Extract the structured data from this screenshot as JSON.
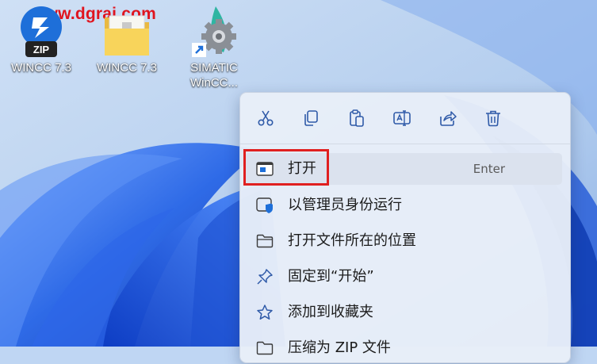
{
  "watermark": "www.dgrai.com",
  "desktop_icons": [
    {
      "label": "WINCC 7.3",
      "badge": "ZIP",
      "icon": "zip-archive-icon"
    },
    {
      "label": "WINCC 7.3",
      "icon": "folder-icon"
    },
    {
      "label_lines": [
        "SIMATIC",
        "WinCC..."
      ],
      "icon": "simatic-wincc-gear-icon"
    }
  ],
  "context_menu": {
    "toolbar": [
      {
        "name": "cut",
        "icon": "scissors-icon"
      },
      {
        "name": "copy",
        "icon": "copy-icon"
      },
      {
        "name": "paste",
        "icon": "paste-icon"
      },
      {
        "name": "rename",
        "icon": "rename-icon"
      },
      {
        "name": "share",
        "icon": "share-icon"
      },
      {
        "name": "delete",
        "icon": "trash-icon"
      }
    ],
    "items": [
      {
        "label": "打开",
        "shortcut": "Enter",
        "icon": "open-window-icon"
      },
      {
        "label": "以管理员身份运行",
        "icon": "shield-run-icon"
      },
      {
        "label": "打开文件所在的位置",
        "icon": "folder-outline-icon"
      },
      {
        "label": "固定到“开始”",
        "icon": "pin-icon"
      },
      {
        "label": "添加到收藏夹",
        "icon": "star-icon"
      },
      {
        "label": "压缩为 ZIP 文件",
        "icon": "zip-folder-icon"
      }
    ]
  },
  "colors": {
    "accent": "#1e6fd9",
    "highlight_border": "#e02020",
    "watermark": "#e0141e"
  }
}
